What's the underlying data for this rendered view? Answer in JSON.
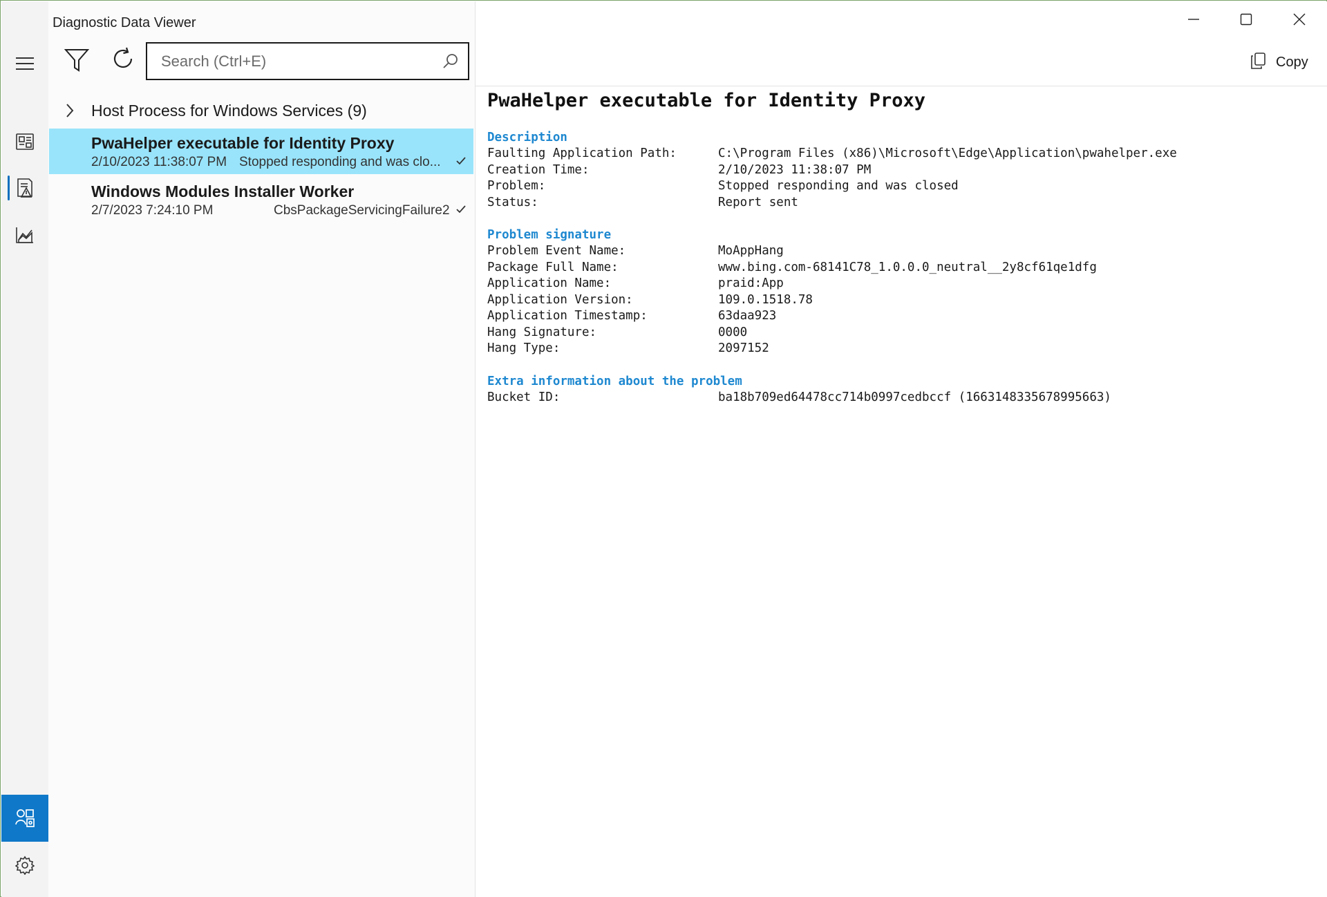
{
  "app": {
    "title": "Diagnostic Data Viewer"
  },
  "window_controls": {
    "minimize": "minimize-icon",
    "maximize": "maximize-icon",
    "close": "close-icon"
  },
  "rail": {
    "items": [
      {
        "icon": "hamburger-menu-icon"
      },
      {
        "icon": "diagnostic-data-icon"
      },
      {
        "icon": "problem-reports-icon",
        "selected": true
      },
      {
        "icon": "office-diagnostic-icon"
      },
      {
        "icon": "user-settings-icon",
        "highlighted": true
      },
      {
        "icon": "gear-icon"
      }
    ],
    "accent_color": "#0f78c8"
  },
  "toolbar": {
    "filter_icon": "filter-icon",
    "refresh_icon": "refresh-icon",
    "search_placeholder": "Search (Ctrl+E)",
    "search_value": ""
  },
  "list": {
    "group": {
      "label": "Host Process for Windows Services (9)",
      "expanded": false
    },
    "items": [
      {
        "title": "PwaHelper executable for Identity Proxy",
        "time": "2/10/2023 11:38:07 PM",
        "status": "Stopped responding and was clo...",
        "selected": true
      },
      {
        "title": "Windows Modules Installer Worker",
        "time": "2/7/2023 7:24:10 PM",
        "status": "CbsPackageServicingFailure2",
        "selected": false
      }
    ],
    "selected_color": "#99e4fb"
  },
  "detail": {
    "copy_label": "Copy",
    "title": "PwaHelper executable for Identity Proxy",
    "section_color": "#1e88d0",
    "sections": [
      {
        "heading": "Description",
        "rows": [
          {
            "key": "Faulting Application Path:",
            "value": "C:\\Program Files (x86)\\Microsoft\\Edge\\Application\\pwahelper.exe"
          },
          {
            "key": "Creation Time:",
            "value": "2/10/2023 11:38:07 PM"
          },
          {
            "key": "Problem:",
            "value": "Stopped responding and was closed"
          },
          {
            "key": "Status:",
            "value": "Report sent"
          }
        ]
      },
      {
        "heading": "Problem signature",
        "rows": [
          {
            "key": "Problem Event Name:",
            "value": "MoAppHang"
          },
          {
            "key": "Package Full Name:",
            "value": "www.bing.com-68141C78_1.0.0.0_neutral__2y8cf61qe1dfg"
          },
          {
            "key": "Application Name:",
            "value": "praid:App"
          },
          {
            "key": "Application Version:",
            "value": "109.0.1518.78"
          },
          {
            "key": "Application Timestamp:",
            "value": "63daa923"
          },
          {
            "key": "Hang Signature:",
            "value": "0000"
          },
          {
            "key": "Hang Type:",
            "value": "2097152"
          }
        ]
      },
      {
        "heading": "Extra information about the problem",
        "rows": [
          {
            "key": "Bucket ID:",
            "value": "ba18b709ed64478cc714b0997cedbccf (1663148335678995663)"
          }
        ]
      }
    ]
  }
}
